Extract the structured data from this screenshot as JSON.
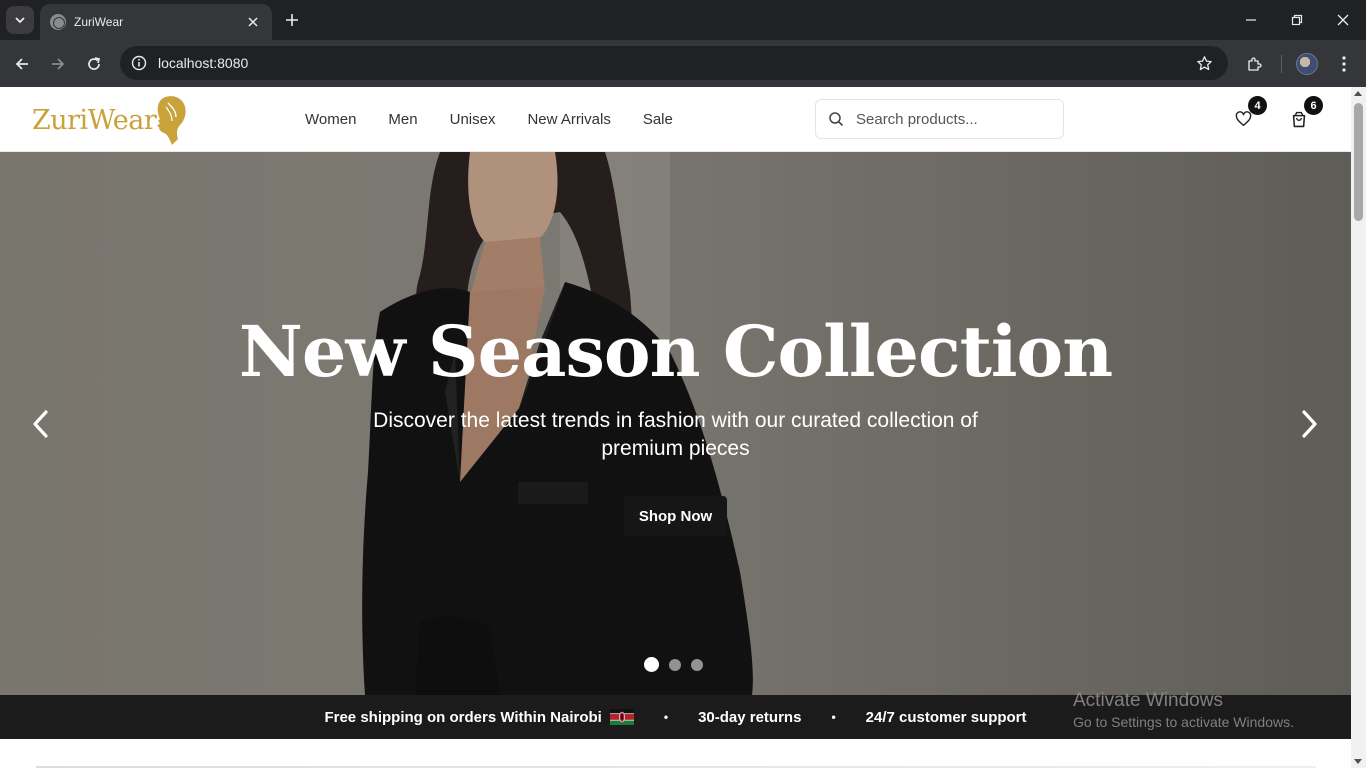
{
  "browser": {
    "tab_title": "ZuriWear",
    "url": "localhost:8080"
  },
  "site": {
    "logo_text": "ZuriWear",
    "nav": [
      "Women",
      "Men",
      "Unisex",
      "New Arrivals",
      "Sale"
    ],
    "search_placeholder": "Search products...",
    "wishlist_count": "4",
    "cart_count": "6"
  },
  "hero": {
    "title": "New Season Collection",
    "subtitle": "Discover the latest trends in fashion with our curated collection of premium pieces",
    "cta": "Shop Now",
    "slides_total": 3,
    "active_slide": 1
  },
  "promo": {
    "items": [
      "Free shipping on orders Within Nairobi",
      "30-day returns",
      "24/7 customer support"
    ],
    "separator": "•"
  },
  "watermark": {
    "title": "Activate Windows",
    "subtitle": "Go to Settings to activate Windows."
  },
  "colors": {
    "brand_gold": "#c9a23a",
    "promo_bg": "#1b1b1b",
    "cta_bg": "#161616"
  },
  "icons": [
    "chevron-down-icon",
    "globe-icon",
    "close-icon",
    "plus-icon",
    "minimize-icon",
    "restore-icon",
    "back-icon",
    "forward-icon",
    "reload-icon",
    "info-icon",
    "star-icon",
    "extensions-icon",
    "menu-icon",
    "search-icon",
    "heart-icon",
    "shopping-bag-icon",
    "chevron-left-icon",
    "chevron-right-icon",
    "kenya-flag-icon"
  ]
}
